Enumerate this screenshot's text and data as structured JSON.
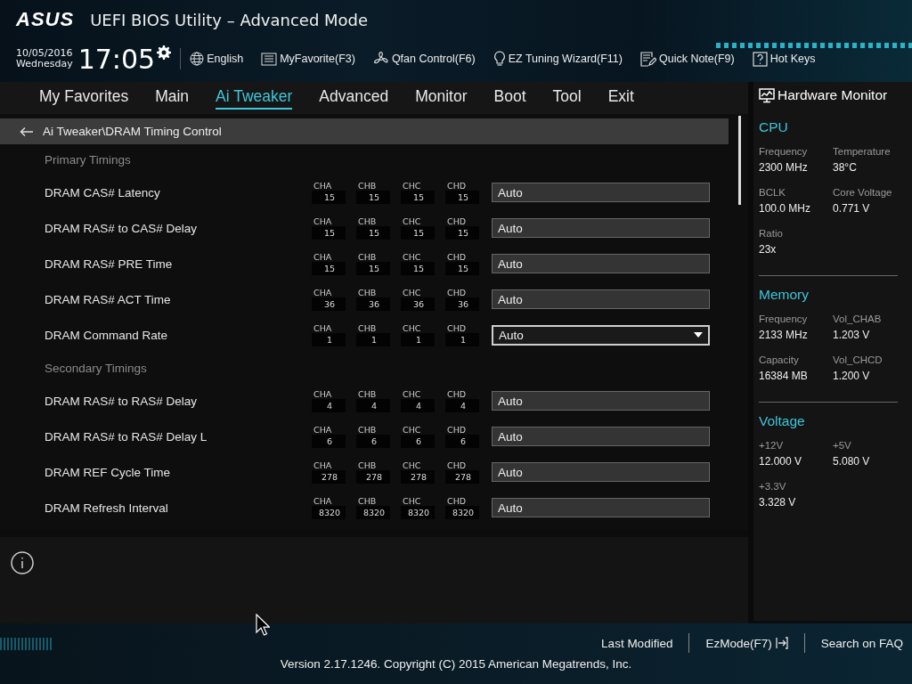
{
  "header": {
    "logo": "ASUS",
    "title": "UEFI BIOS Utility – Advanced Mode"
  },
  "toolbar": {
    "date": "10/05/2016",
    "day": "Wednesday",
    "time": "17:05",
    "items": [
      {
        "kind": "globe",
        "label": "English"
      },
      {
        "kind": "list",
        "label": "MyFavorite(F3)"
      },
      {
        "kind": "fan",
        "label": "Qfan Control(F6)"
      },
      {
        "kind": "bulb",
        "label": "EZ Tuning Wizard(F11)"
      },
      {
        "kind": "note",
        "label": "Quick Note(F9)"
      },
      {
        "kind": "help",
        "label": "Hot Keys"
      }
    ]
  },
  "tabs": [
    {
      "label": "My Favorites",
      "selected": false
    },
    {
      "label": "Main",
      "selected": false
    },
    {
      "label": "Ai Tweaker",
      "selected": true
    },
    {
      "label": "Advanced",
      "selected": false
    },
    {
      "label": "Monitor",
      "selected": false
    },
    {
      "label": "Boot",
      "selected": false
    },
    {
      "label": "Tool",
      "selected": false
    },
    {
      "label": "Exit",
      "selected": false
    }
  ],
  "breadcrumb": "Ai Tweaker\\DRAM Timing Control",
  "sections": [
    {
      "title": "Primary Timings",
      "rows": [
        {
          "label": "DRAM CAS# Latency",
          "kind": "text",
          "value": "Auto",
          "channels": [
            {
              "name": "CHA",
              "value": "15"
            },
            {
              "name": "CHB",
              "value": "15"
            },
            {
              "name": "CHC",
              "value": "15"
            },
            {
              "name": "CHD",
              "value": "15"
            }
          ]
        },
        {
          "label": "DRAM RAS# to CAS# Delay",
          "kind": "text",
          "value": "Auto",
          "channels": [
            {
              "name": "CHA",
              "value": "15"
            },
            {
              "name": "CHB",
              "value": "15"
            },
            {
              "name": "CHC",
              "value": "15"
            },
            {
              "name": "CHD",
              "value": "15"
            }
          ]
        },
        {
          "label": "DRAM RAS# PRE Time",
          "kind": "text",
          "value": "Auto",
          "channels": [
            {
              "name": "CHA",
              "value": "15"
            },
            {
              "name": "CHB",
              "value": "15"
            },
            {
              "name": "CHC",
              "value": "15"
            },
            {
              "name": "CHD",
              "value": "15"
            }
          ]
        },
        {
          "label": "DRAM RAS# ACT Time",
          "kind": "text",
          "value": "Auto",
          "channels": [
            {
              "name": "CHA",
              "value": "36"
            },
            {
              "name": "CHB",
              "value": "36"
            },
            {
              "name": "CHC",
              "value": "36"
            },
            {
              "name": "CHD",
              "value": "36"
            }
          ]
        },
        {
          "label": "DRAM Command Rate",
          "kind": "dropdown",
          "value": "Auto",
          "channels": [
            {
              "name": "CHA",
              "value": "1"
            },
            {
              "name": "CHB",
              "value": "1"
            },
            {
              "name": "CHC",
              "value": "1"
            },
            {
              "name": "CHD",
              "value": "1"
            }
          ]
        }
      ]
    },
    {
      "title": "Secondary Timings",
      "rows": [
        {
          "label": "DRAM RAS# to RAS# Delay",
          "kind": "text",
          "value": "Auto",
          "channels": [
            {
              "name": "CHA",
              "value": "4"
            },
            {
              "name": "CHB",
              "value": "4"
            },
            {
              "name": "CHC",
              "value": "4"
            },
            {
              "name": "CHD",
              "value": "4"
            }
          ]
        },
        {
          "label": "DRAM RAS# to RAS# Delay L",
          "kind": "text",
          "value": "Auto",
          "channels": [
            {
              "name": "CHA",
              "value": "6"
            },
            {
              "name": "CHB",
              "value": "6"
            },
            {
              "name": "CHC",
              "value": "6"
            },
            {
              "name": "CHD",
              "value": "6"
            }
          ]
        },
        {
          "label": "DRAM REF Cycle Time",
          "kind": "text",
          "value": "Auto",
          "channels": [
            {
              "name": "CHA",
              "value": "278"
            },
            {
              "name": "CHB",
              "value": "278"
            },
            {
              "name": "CHC",
              "value": "278"
            },
            {
              "name": "CHD",
              "value": "278"
            }
          ]
        },
        {
          "label": "DRAM Refresh Interval",
          "kind": "text",
          "value": "Auto",
          "channels": [
            {
              "name": "CHA",
              "value": "8320"
            },
            {
              "name": "CHB",
              "value": "8320"
            },
            {
              "name": "CHC",
              "value": "8320"
            },
            {
              "name": "CHD",
              "value": "8320"
            }
          ]
        }
      ]
    }
  ],
  "hardware_monitor": {
    "title": "Hardware Monitor",
    "groups": [
      {
        "title": "CPU",
        "items": [
          {
            "label": "Frequency",
            "value": "2300 MHz"
          },
          {
            "label": "Temperature",
            "value": "38°C"
          },
          {
            "label": "BCLK",
            "value": "100.0 MHz"
          },
          {
            "label": "Core Voltage",
            "value": "0.771 V"
          },
          {
            "label": "Ratio",
            "value": "23x"
          }
        ]
      },
      {
        "title": "Memory",
        "items": [
          {
            "label": "Frequency",
            "value": "2133 MHz"
          },
          {
            "label": "Vol_CHAB",
            "value": "1.203 V"
          },
          {
            "label": "Capacity",
            "value": "16384 MB"
          },
          {
            "label": "Vol_CHCD",
            "value": "1.200 V"
          }
        ]
      },
      {
        "title": "Voltage",
        "items": [
          {
            "label": "+12V",
            "value": "12.000 V"
          },
          {
            "label": "+5V",
            "value": "5.080 V"
          },
          {
            "label": "+3.3V",
            "value": "3.328 V"
          }
        ]
      }
    ]
  },
  "footer": {
    "links": [
      "Last Modified",
      "EzMode(F7)",
      "Search on FAQ"
    ],
    "version": "Version 2.17.1246. Copyright (C) 2015 American Megatrends, Inc."
  }
}
